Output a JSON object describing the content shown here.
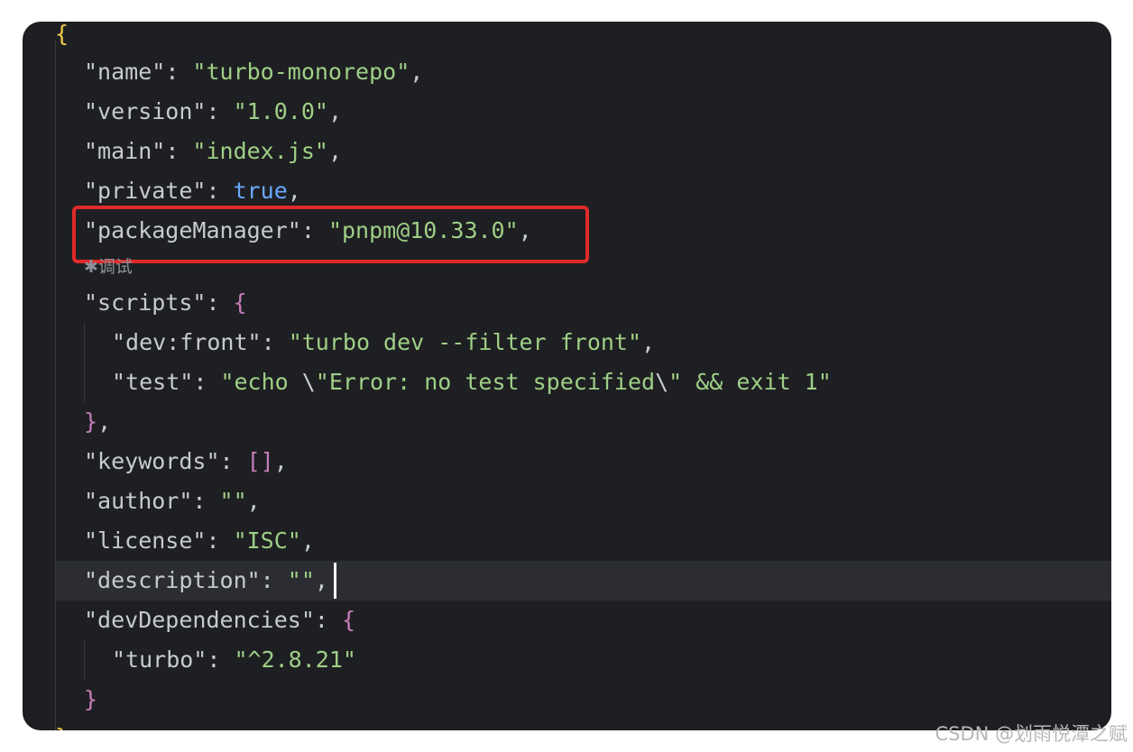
{
  "editor": {
    "open_brace": "{",
    "close_brace_partial": "}",
    "inline_hint": "✱调试",
    "watermark": "CSDN @划雨悦潭之赋",
    "lines": {
      "name": {
        "key": "\"name\"",
        "colon": ": ",
        "value": "\"turbo-monorepo\"",
        "comma": ","
      },
      "version": {
        "key": "\"version\"",
        "colon": ": ",
        "value": "\"1.0.0\"",
        "comma": ","
      },
      "main": {
        "key": "\"main\"",
        "colon": ": ",
        "value": "\"index.js\"",
        "comma": ","
      },
      "private": {
        "key": "\"private\"",
        "colon": ": ",
        "value": "true",
        "comma": ","
      },
      "packageManager": {
        "key": "\"packageManager\"",
        "colon": ": ",
        "value": "\"pnpm@10.33.0\"",
        "comma": ","
      },
      "scripts": {
        "key": "\"scripts\"",
        "colon": ": ",
        "brace": "{"
      },
      "dev_front": {
        "key": "\"dev:front\"",
        "colon": ": ",
        "value": "\"turbo dev --filter front\"",
        "comma": ","
      },
      "test": {
        "key": "\"test\"",
        "colon": ": ",
        "value_a": "\"echo ",
        "esc_a": "\\",
        "value_b": "\"Error: no test specified",
        "esc_b": "\\",
        "value_c": "\" && exit 1\""
      },
      "scripts_close": {
        "brace": "}",
        "comma": ","
      },
      "keywords": {
        "key": "\"keywords\"",
        "colon": ": ",
        "value": "[]",
        "comma": ","
      },
      "author": {
        "key": "\"author\"",
        "colon": ": ",
        "value": "\"\"",
        "comma": ","
      },
      "license": {
        "key": "\"license\"",
        "colon": ": ",
        "value": "\"ISC\"",
        "comma": ","
      },
      "description": {
        "key": "\"description\"",
        "colon": ": ",
        "value": "\"\"",
        "comma": ","
      },
      "devDependencies": {
        "key": "\"devDependencies\"",
        "colon": ": ",
        "brace": "{"
      },
      "turbo": {
        "key": "\"turbo\"",
        "colon": ": ",
        "value": "\"^2.8.21\""
      },
      "dev_close": {
        "brace": "}"
      }
    }
  },
  "colors": {
    "background": "#1e1f22",
    "key": "#c7cacf",
    "string": "#9fcf86",
    "keyword": "#6aa8ff",
    "bracket": "#c77dbb",
    "highlight_box": "#e02a2a"
  }
}
